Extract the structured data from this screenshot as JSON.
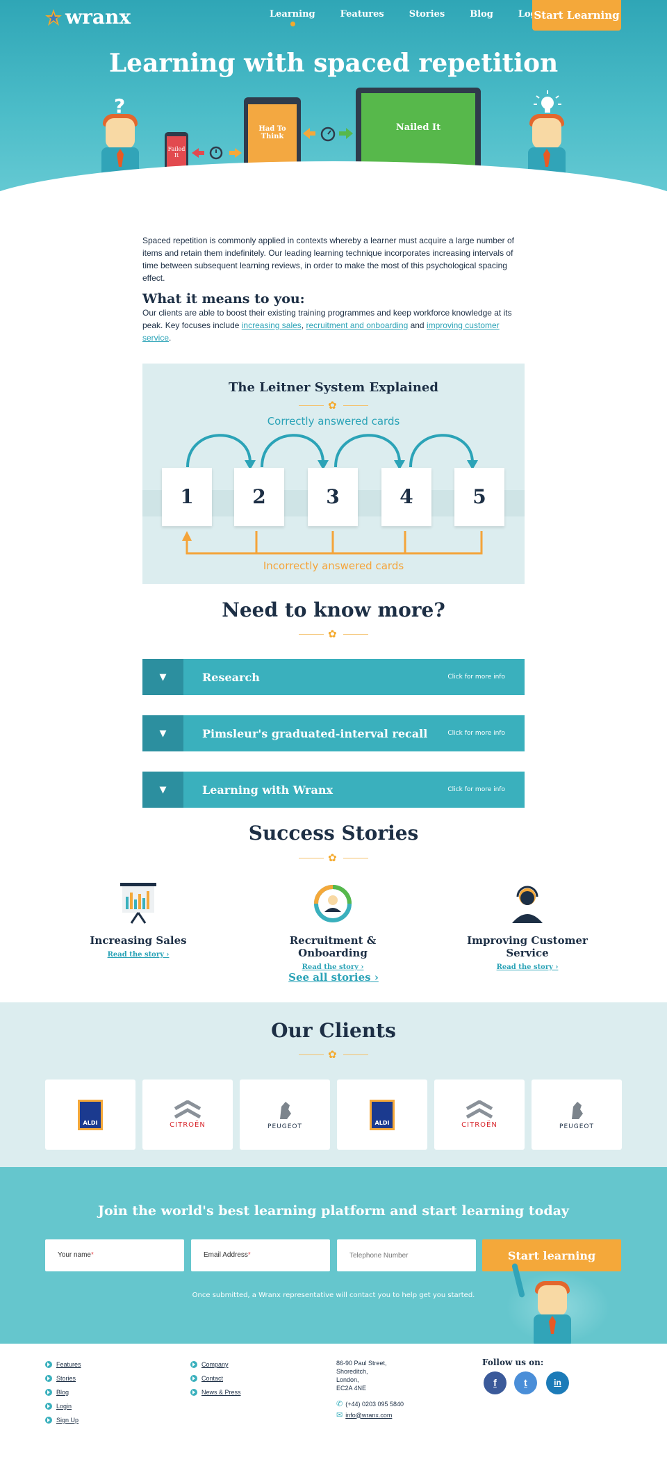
{
  "brand": {
    "name": "wranx"
  },
  "nav": {
    "items": [
      "Learning",
      "Features",
      "Stories",
      "Blog",
      "Login"
    ],
    "cta": "Start Learning"
  },
  "hero": {
    "title": "Learning with spaced repetition",
    "phone_text": "Failed It",
    "tablet_text": "Had To Think",
    "laptop_text": "Nailed It",
    "question_mark": "?"
  },
  "intro": {
    "paragraph": "Spaced repetition is commonly applied in contexts whereby a learner must acquire a large number of items and retain them indefinitely. Our leading learning technique incorporates increasing intervals of time between subsequent learning reviews, in order to make the most of this psychological spacing effect.",
    "heading": "What it means to you:",
    "p2_start": "Our clients are able to boost their existing training programmes and keep workforce knowledge at its peak. Key focuses include ",
    "link1": "increasing sales",
    "sep1": ", ",
    "link2": "recruitment and onboarding",
    "sep2": " and ",
    "link3": "improving customer service",
    "end": "."
  },
  "leitner": {
    "title": "The Leitner System Explained",
    "correct": "Correctly answered cards",
    "incorrect": "Incorrectly answered cards",
    "boxes": [
      "1",
      "2",
      "3",
      "4",
      "5"
    ]
  },
  "faq": {
    "title": "Need to know more?",
    "more": "Click for more info",
    "items": [
      "Research",
      "Pimsleur's graduated-interval recall",
      "Learning with Wranx"
    ]
  },
  "stories": {
    "title": "Success Stories",
    "read": "Read the story",
    "items": [
      "Increasing Sales",
      "Recruitment & Onboarding",
      "Improving Customer Service"
    ],
    "see_all": "See all stories"
  },
  "clients": {
    "title": "Our Clients",
    "logos": [
      "ALDI",
      "CITROËN",
      "PEUGEOT",
      "ALDI",
      "CITROËN",
      "PEUGEOT"
    ]
  },
  "join": {
    "title": "Join the world's best learning platform and start learning today",
    "name_ph": "Your name",
    "email_ph": "Email Address",
    "phone_ph": "Telephone Number",
    "required_mark": "*",
    "button": "Start learning",
    "note": "Once submitted, a Wranx representative will contact you to help get you started."
  },
  "footer": {
    "col1": [
      "Features",
      "Stories",
      "Blog",
      "Login",
      "Sign Up"
    ],
    "col2": [
      "Company",
      "Contact",
      "News & Press"
    ],
    "address": [
      "86-90 Paul Street,",
      "Shoreditch,",
      "London,",
      "EC2A 4NE"
    ],
    "phone": "(+44) 0203 095 5840",
    "email": "info@wranx.com",
    "follow": "Follow us on:",
    "social": [
      "f",
      "t",
      "in"
    ]
  },
  "colors": {
    "teal": "#3ab0bd",
    "orange": "#f4a83a",
    "navy": "#1d2f45",
    "light": "#dcedef"
  }
}
